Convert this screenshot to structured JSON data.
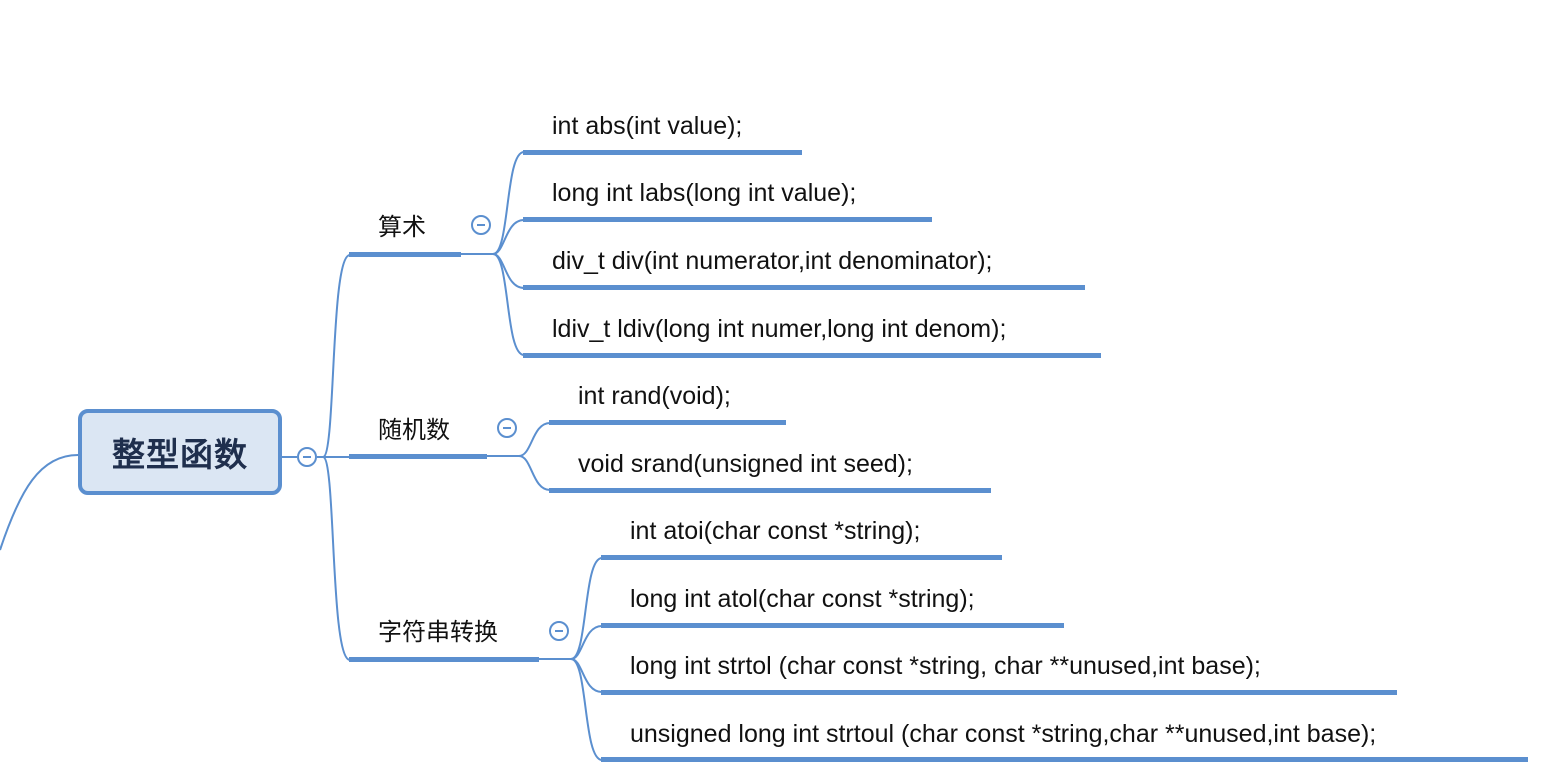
{
  "root": {
    "label": "整型函数"
  },
  "categories": [
    {
      "label": "算术",
      "items": [
        "int abs(int value);",
        "long int labs(long int value);",
        "div_t div(int numerator,int denominator);",
        "ldiv_t ldiv(long int numer,long int denom);"
      ]
    },
    {
      "label": "随机数",
      "items": [
        "int rand(void);",
        "void srand(unsigned int seed);"
      ]
    },
    {
      "label": "字符串转换",
      "items": [
        "int atoi(char const *string);",
        "long int atol(char const *string);",
        "long int strtol (char const *string, char **unused,int base);",
        "unsigned long int strtoul (char const *string,char **unused,int base);"
      ]
    }
  ],
  "colors": {
    "line": "#5b8fcf",
    "root_fill": "#dbe6f3",
    "root_text": "#1f2f4d"
  }
}
